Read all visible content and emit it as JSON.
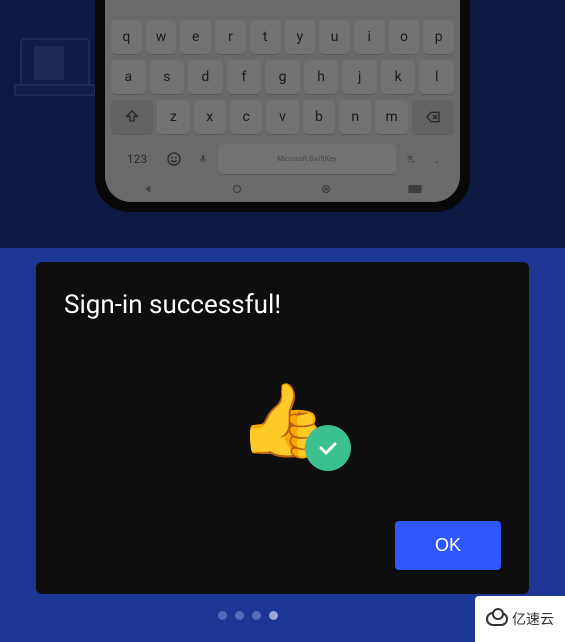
{
  "keyboard": {
    "row0": [
      "q",
      "w",
      "e",
      "r",
      "t",
      "y",
      "u",
      "i",
      "o",
      "p"
    ],
    "row1": [
      "a",
      "s",
      "d",
      "f",
      "g",
      "h",
      "j",
      "k",
      "l"
    ],
    "row2": [
      "z",
      "x",
      "c",
      "v",
      "b",
      "n",
      "m"
    ],
    "mode_key": "123",
    "spacebar_label": "Microsoft SwiftKey",
    "punct_key": "?!,",
    "period_key": "."
  },
  "dialog": {
    "title": "Sign-in successful!",
    "ok_label": "OK"
  },
  "pagination": {
    "count": 4,
    "active_index": 3
  },
  "watermark": {
    "text": "亿速云"
  }
}
